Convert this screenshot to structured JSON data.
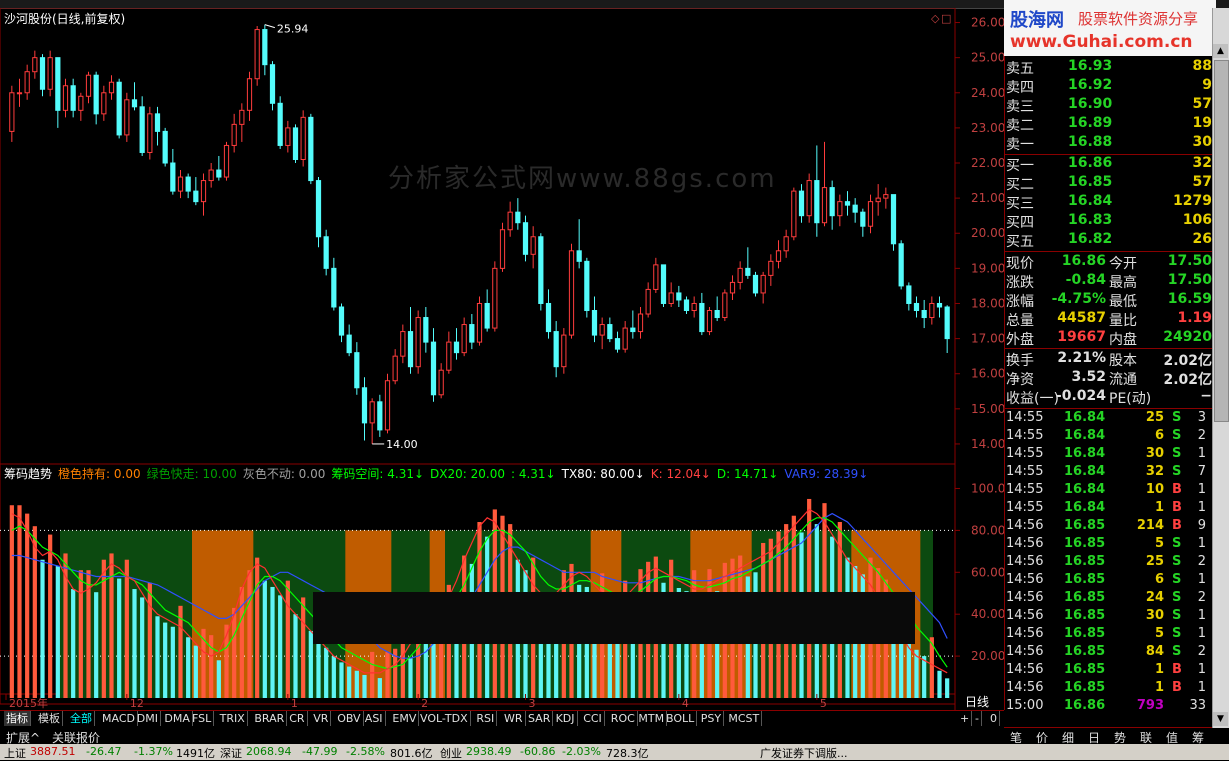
{
  "window": {
    "title": "沙河股份(日线,前复权)",
    "watermark": "分析家公式网www.88gs.com",
    "high_marker": "25.94",
    "low_marker": "14.00"
  },
  "price_axis": [
    "26.00",
    "25.00",
    "24.00",
    "23.00",
    "22.00",
    "21.00",
    "20.00",
    "19.00",
    "18.00",
    "17.00",
    "16.00",
    "15.00",
    "14.00"
  ],
  "indicator_axis": [
    "100.0",
    "80.00",
    "60.00",
    "40.00",
    "20.00"
  ],
  "period_label": "日线",
  "x_labels": [
    "2015年",
    "12",
    "1",
    "2",
    "3",
    "4",
    "5"
  ],
  "indicator_header": [
    {
      "text": "筹码趋势",
      "color": "#ffffff"
    },
    {
      "text": "橙色持有: 0.00",
      "color": "#ff8000"
    },
    {
      "text": "绿色快走: 10.00",
      "color": "#00a000"
    },
    {
      "text": "灰色不动: 0.00",
      "color": "#a0a0a0"
    },
    {
      "text": "筹码空间: 4.31↓",
      "color": "#00ff00"
    },
    {
      "text": "DX20: 20.00",
      "color": "#00ff00"
    },
    {
      "text": ": 4.31↓",
      "color": "#00ff00"
    },
    {
      "text": "TX80: 80.00↓",
      "color": "#ffffff"
    },
    {
      "text": "K: 12.04↓",
      "color": "#ff4040"
    },
    {
      "text": "D: 14.71↓",
      "color": "#00ff00"
    },
    {
      "text": "VAR9: 28.39↓",
      "color": "#3050ff"
    }
  ],
  "logo": {
    "name": "股海网",
    "slogan": "股票软件资源分享",
    "url": "www.Guhai.com.cn"
  },
  "order_book": {
    "sell": [
      {
        "label": "卖五",
        "price": "16.93",
        "vol": "88"
      },
      {
        "label": "卖四",
        "price": "16.92",
        "vol": "9"
      },
      {
        "label": "卖三",
        "price": "16.90",
        "vol": "57"
      },
      {
        "label": "卖二",
        "price": "16.89",
        "vol": "19"
      },
      {
        "label": "卖一",
        "price": "16.88",
        "vol": "30"
      }
    ],
    "buy": [
      {
        "label": "买一",
        "price": "16.86",
        "vol": "32"
      },
      {
        "label": "买二",
        "price": "16.85",
        "vol": "57"
      },
      {
        "label": "买三",
        "price": "16.84",
        "vol": "1279"
      },
      {
        "label": "买四",
        "price": "16.83",
        "vol": "106"
      },
      {
        "label": "买五",
        "price": "16.82",
        "vol": "26"
      }
    ]
  },
  "stats": [
    {
      "l1": "现价",
      "v1": "16.86",
      "c1": "#25d425",
      "l2": "今开",
      "v2": "17.50",
      "c2": "#25d425"
    },
    {
      "l1": "涨跌",
      "v1": "-0.84",
      "c1": "#25d425",
      "l2": "最高",
      "v2": "17.50",
      "c2": "#25d425"
    },
    {
      "l1": "涨幅",
      "v1": "-4.75%",
      "c1": "#25d425",
      "l2": "最低",
      "v2": "16.59",
      "c2": "#25d425"
    },
    {
      "l1": "总量",
      "v1": "44587",
      "c1": "#e7d000",
      "l2": "量比",
      "v2": "1.19",
      "c2": "#ff4040"
    },
    {
      "l1": "外盘",
      "v1": "19667",
      "c1": "#ff4040",
      "l2": "内盘",
      "v2": "24920",
      "c2": "#25d425"
    }
  ],
  "stats2": [
    {
      "l1": "换手",
      "v1": "2.21%",
      "c1": "#e0e0e0",
      "l2": "股本",
      "v2": "2.02亿",
      "c2": "#e0e0e0"
    },
    {
      "l1": "净资",
      "v1": "3.52",
      "c1": "#e0e0e0",
      "l2": "流通",
      "v2": "2.02亿",
      "c2": "#e0e0e0"
    },
    {
      "l1": "收益(一)",
      "v1": "-0.024",
      "c1": "#e0e0e0",
      "l2": "PE(动)",
      "v2": "−",
      "c2": "#e0e0e0"
    }
  ],
  "ticks": [
    {
      "t": "14:55",
      "p": "16.84",
      "v": "25",
      "d": "S",
      "n": "3"
    },
    {
      "t": "14:55",
      "p": "16.84",
      "v": "6",
      "d": "S",
      "n": "2"
    },
    {
      "t": "14:55",
      "p": "16.84",
      "v": "30",
      "d": "S",
      "n": "1"
    },
    {
      "t": "14:55",
      "p": "16.84",
      "v": "32",
      "d": "S",
      "n": "7"
    },
    {
      "t": "14:55",
      "p": "16.84",
      "v": "10",
      "d": "B",
      "n": "1"
    },
    {
      "t": "14:55",
      "p": "16.84",
      "v": "1",
      "d": "B",
      "n": "1"
    },
    {
      "t": "14:56",
      "p": "16.85",
      "v": "214",
      "d": "B",
      "n": "9"
    },
    {
      "t": "14:56",
      "p": "16.85",
      "v": "5",
      "d": "S",
      "n": "1"
    },
    {
      "t": "14:56",
      "p": "16.85",
      "v": "25",
      "d": "S",
      "n": "2"
    },
    {
      "t": "14:56",
      "p": "16.85",
      "v": "6",
      "d": "S",
      "n": "1"
    },
    {
      "t": "14:56",
      "p": "16.85",
      "v": "24",
      "d": "S",
      "n": "2"
    },
    {
      "t": "14:56",
      "p": "16.85",
      "v": "30",
      "d": "S",
      "n": "1"
    },
    {
      "t": "14:56",
      "p": "16.85",
      "v": "5",
      "d": "S",
      "n": "1"
    },
    {
      "t": "14:56",
      "p": "16.85",
      "v": "84",
      "d": "S",
      "n": "2"
    },
    {
      "t": "14:56",
      "p": "16.85",
      "v": "1",
      "d": "B",
      "n": "1"
    },
    {
      "t": "14:56",
      "p": "16.85",
      "v": "1",
      "d": "B",
      "n": "1"
    },
    {
      "t": "15:00",
      "p": "16.86",
      "v": "793",
      "d": "",
      "n": "33"
    }
  ],
  "tabs": [
    "指标",
    "模板",
    "全部",
    "MACD",
    "DMI",
    "DMA",
    "FSL",
    "TRIX",
    "BRAR",
    "CR",
    "VR",
    "OBV",
    "ASI",
    "EMV",
    "VOL-TDX",
    "RSI",
    "WR",
    "SAR",
    "KDJ",
    "CCI",
    "ROC",
    "MTM",
    "BOLL",
    "PSY",
    "MCST"
  ],
  "bottom_tabs": [
    "扩展^",
    "关联报价"
  ],
  "right_tabs": [
    "笔",
    "价",
    "细",
    "日",
    "势",
    "联",
    "值",
    "筹"
  ],
  "zoom_controls": [
    "+",
    "-",
    "0"
  ],
  "status": {
    "sh": "上证",
    "sh_val": "3887.51",
    "sh_chg": "-26.47",
    "sh_pct": "-1.37%",
    "sh_amt": "1491亿",
    "sz": "深证",
    "sz_val": "2068.94",
    "sz_chg": "-47.99",
    "sz_pct": "-2.58%",
    "sz_amt": "801.6亿",
    "cy": "创业",
    "cy_val": "2938.49",
    "cy_chg": "-60.86",
    "cy_pct": "-2.03%",
    "cy_amt": "728.3亿",
    "news": "广发证券下调版..."
  },
  "chart_data": {
    "type": "candlestick",
    "title": "沙河股份(日线,前复权)",
    "ylim": [
      13.6,
      26.3
    ],
    "candles": [
      [
        22.9,
        24.2,
        22.6,
        24.0
      ],
      [
        24.0,
        24.4,
        23.6,
        24.0
      ],
      [
        24.0,
        24.8,
        23.8,
        24.6
      ],
      [
        24.6,
        25.2,
        24.4,
        25.0
      ],
      [
        25.0,
        25.1,
        23.9,
        24.1
      ],
      [
        24.1,
        25.2,
        23.9,
        25.0
      ],
      [
        25.0,
        25.0,
        23.0,
        23.5
      ],
      [
        23.5,
        24.4,
        23.3,
        24.2
      ],
      [
        24.2,
        24.4,
        23.3,
        23.5
      ],
      [
        23.5,
        24.0,
        23.2,
        23.9
      ],
      [
        23.9,
        24.6,
        23.7,
        24.5
      ],
      [
        24.5,
        24.6,
        23.1,
        23.4
      ],
      [
        23.4,
        24.2,
        23.2,
        24.0
      ],
      [
        24.0,
        24.5,
        23.8,
        24.3
      ],
      [
        24.3,
        24.4,
        22.7,
        22.8
      ],
      [
        22.8,
        24.0,
        22.6,
        23.8
      ],
      [
        23.8,
        24.3,
        23.5,
        23.6
      ],
      [
        23.6,
        23.9,
        22.2,
        22.3
      ],
      [
        22.3,
        23.6,
        22.1,
        23.4
      ],
      [
        23.4,
        23.6,
        22.5,
        22.9
      ],
      [
        22.9,
        23.0,
        21.9,
        22.0
      ],
      [
        22.0,
        22.4,
        21.1,
        21.2
      ],
      [
        21.2,
        21.8,
        21.0,
        21.6
      ],
      [
        21.6,
        21.7,
        21.0,
        21.2
      ],
      [
        21.2,
        21.6,
        20.8,
        20.9
      ],
      [
        20.9,
        21.7,
        20.5,
        21.5
      ],
      [
        21.5,
        22.0,
        21.3,
        21.8
      ],
      [
        21.8,
        22.2,
        21.5,
        21.6
      ],
      [
        21.6,
        22.6,
        21.5,
        22.5
      ],
      [
        22.5,
        23.4,
        22.3,
        23.1
      ],
      [
        23.1,
        23.7,
        22.6,
        23.5
      ],
      [
        23.5,
        24.6,
        23.2,
        24.4
      ],
      [
        24.4,
        25.9,
        24.2,
        25.8
      ],
      [
        25.8,
        25.94,
        24.5,
        24.8
      ],
      [
        24.8,
        24.9,
        23.5,
        23.7
      ],
      [
        23.7,
        23.9,
        22.4,
        22.5
      ],
      [
        22.5,
        23.2,
        22.3,
        23.0
      ],
      [
        23.0,
        23.1,
        22.0,
        22.1
      ],
      [
        22.1,
        23.5,
        21.9,
        23.3
      ],
      [
        23.3,
        23.4,
        21.4,
        21.5
      ],
      [
        21.5,
        21.6,
        19.6,
        19.9
      ],
      [
        19.9,
        20.1,
        18.8,
        19.0
      ],
      [
        19.0,
        19.3,
        17.8,
        17.9
      ],
      [
        17.9,
        18.0,
        16.9,
        17.1
      ],
      [
        17.1,
        17.4,
        16.5,
        16.6
      ],
      [
        16.6,
        16.9,
        15.4,
        15.6
      ],
      [
        15.6,
        15.9,
        14.1,
        14.6
      ],
      [
        14.6,
        15.3,
        14.0,
        15.2
      ],
      [
        15.2,
        15.4,
        14.2,
        14.4
      ],
      [
        14.4,
        16.0,
        14.3,
        15.8
      ],
      [
        15.8,
        16.7,
        15.7,
        16.5
      ],
      [
        16.5,
        17.4,
        16.3,
        17.2
      ],
      [
        17.2,
        17.9,
        16.0,
        16.2
      ],
      [
        16.2,
        17.8,
        16.0,
        17.6
      ],
      [
        17.6,
        17.9,
        16.6,
        16.9
      ],
      [
        16.9,
        17.3,
        15.2,
        15.4
      ],
      [
        15.4,
        16.3,
        15.3,
        16.1
      ],
      [
        16.1,
        17.2,
        16.0,
        16.9
      ],
      [
        16.9,
        17.3,
        16.4,
        16.6
      ],
      [
        16.6,
        17.6,
        16.5,
        17.4
      ],
      [
        17.4,
        17.7,
        16.7,
        16.9
      ],
      [
        16.9,
        18.2,
        16.8,
        18.0
      ],
      [
        18.0,
        18.4,
        17.2,
        17.3
      ],
      [
        17.3,
        19.2,
        17.2,
        19.0
      ],
      [
        19.0,
        20.3,
        18.9,
        20.1
      ],
      [
        20.1,
        20.9,
        19.9,
        20.6
      ],
      [
        20.6,
        21.0,
        20.1,
        20.3
      ],
      [
        20.3,
        20.5,
        19.2,
        19.4
      ],
      [
        19.4,
        20.2,
        19.0,
        19.9
      ],
      [
        19.9,
        20.0,
        17.8,
        18.0
      ],
      [
        18.0,
        18.4,
        17.0,
        17.2
      ],
      [
        17.2,
        17.5,
        15.9,
        16.2
      ],
      [
        16.2,
        17.3,
        16.0,
        17.1
      ],
      [
        17.1,
        19.7,
        17.0,
        19.5
      ],
      [
        19.5,
        20.4,
        19.0,
        19.2
      ],
      [
        19.2,
        19.3,
        17.6,
        17.8
      ],
      [
        17.8,
        18.2,
        16.9,
        17.1
      ],
      [
        17.1,
        17.6,
        16.7,
        17.4
      ],
      [
        17.4,
        17.6,
        16.9,
        17.0
      ],
      [
        17.0,
        17.2,
        16.6,
        16.7
      ],
      [
        16.7,
        17.5,
        16.6,
        17.3
      ],
      [
        17.3,
        17.8,
        17.0,
        17.2
      ],
      [
        17.2,
        17.9,
        17.0,
        17.7
      ],
      [
        17.7,
        18.6,
        17.6,
        18.4
      ],
      [
        18.4,
        19.3,
        18.3,
        19.1
      ],
      [
        19.1,
        19.1,
        17.9,
        18.0
      ],
      [
        18.0,
        18.6,
        17.9,
        18.3
      ],
      [
        18.3,
        18.5,
        17.9,
        18.1
      ],
      [
        18.1,
        18.2,
        17.7,
        17.8
      ],
      [
        17.8,
        18.2,
        17.6,
        18.0
      ],
      [
        18.0,
        18.3,
        17.1,
        17.2
      ],
      [
        17.2,
        17.9,
        17.1,
        17.8
      ],
      [
        17.8,
        18.2,
        17.5,
        17.6
      ],
      [
        17.6,
        18.4,
        17.5,
        18.3
      ],
      [
        18.3,
        18.8,
        18.1,
        18.6
      ],
      [
        18.6,
        19.2,
        18.4,
        19.0
      ],
      [
        19.0,
        19.6,
        18.7,
        18.8
      ],
      [
        18.8,
        18.9,
        18.2,
        18.3
      ],
      [
        18.3,
        18.9,
        18.0,
        18.8
      ],
      [
        18.8,
        19.4,
        18.5,
        19.2
      ],
      [
        19.2,
        19.8,
        19.0,
        19.5
      ],
      [
        19.5,
        20.1,
        19.3,
        19.9
      ],
      [
        19.9,
        21.3,
        19.8,
        21.2
      ],
      [
        21.2,
        21.4,
        20.3,
        20.5
      ],
      [
        20.5,
        21.7,
        20.3,
        21.5
      ],
      [
        21.5,
        22.5,
        19.9,
        20.3
      ],
      [
        20.3,
        22.6,
        20.2,
        21.3
      ],
      [
        21.3,
        21.5,
        20.1,
        20.5
      ],
      [
        20.5,
        21.1,
        20.2,
        20.9
      ],
      [
        20.9,
        21.2,
        20.5,
        20.8
      ],
      [
        20.8,
        21.0,
        20.3,
        20.6
      ],
      [
        20.6,
        20.7,
        19.9,
        20.2
      ],
      [
        20.2,
        21.1,
        20.0,
        20.9
      ],
      [
        20.9,
        21.4,
        20.5,
        21.0
      ],
      [
        21.0,
        21.3,
        20.7,
        21.1
      ],
      [
        21.1,
        21.1,
        19.5,
        19.7
      ],
      [
        19.7,
        19.8,
        18.4,
        18.5
      ],
      [
        18.5,
        18.6,
        17.8,
        18.0
      ],
      [
        18.0,
        18.2,
        17.6,
        17.8
      ],
      [
        17.8,
        18.1,
        17.3,
        17.6
      ],
      [
        17.6,
        18.2,
        17.4,
        18.0
      ],
      [
        18.0,
        18.2,
        17.6,
        17.9
      ],
      [
        17.9,
        17.95,
        16.59,
        17.0
      ]
    ],
    "indicator_ylim": [
      0,
      105
    ],
    "K": [
      88,
      86,
      80,
      72,
      68,
      70,
      66,
      58,
      52,
      50,
      52,
      55,
      60,
      64,
      62,
      58,
      56,
      50,
      44,
      40,
      38,
      36,
      34,
      30,
      26,
      22,
      20,
      22,
      30,
      40,
      52,
      60,
      64,
      62,
      56,
      50,
      44,
      40,
      36,
      32,
      28,
      24,
      20,
      18,
      16,
      14,
      12,
      12,
      12,
      14,
      16,
      20,
      26,
      32,
      38,
      42,
      44,
      48,
      56,
      66,
      74,
      82,
      86,
      84,
      78,
      72,
      66,
      60,
      54,
      50,
      48,
      50,
      54,
      58,
      60,
      58,
      54,
      50,
      48,
      46,
      48,
      52,
      56,
      60,
      62,
      60,
      58,
      56,
      54,
      52,
      52,
      54,
      56,
      58,
      60,
      62,
      64,
      66,
      68,
      70,
      74,
      78,
      82,
      86,
      90,
      88,
      84,
      78,
      72,
      66,
      62,
      58,
      54,
      48,
      42,
      36,
      30,
      24,
      20,
      18,
      16,
      14,
      12.04
    ],
    "D": [
      80,
      82,
      80,
      76,
      72,
      70,
      68,
      64,
      60,
      56,
      54,
      54,
      56,
      58,
      60,
      58,
      56,
      54,
      50,
      46,
      42,
      40,
      38,
      36,
      32,
      28,
      24,
      22,
      24,
      30,
      38,
      46,
      54,
      58,
      58,
      56,
      52,
      48,
      44,
      40,
      36,
      32,
      28,
      24,
      22,
      20,
      18,
      16,
      15,
      14,
      15,
      16,
      20,
      24,
      30,
      36,
      40,
      44,
      48,
      54,
      62,
      70,
      76,
      80,
      80,
      78,
      74,
      70,
      64,
      58,
      54,
      52,
      52,
      54,
      56,
      56,
      55,
      53,
      51,
      49,
      48,
      49,
      51,
      54,
      57,
      58,
      58,
      57,
      56,
      54,
      53,
      53,
      54,
      55,
      57,
      58,
      60,
      62,
      64,
      66,
      69,
      72,
      76,
      80,
      84,
      86,
      86,
      84,
      80,
      76,
      72,
      68,
      64,
      60,
      55,
      50,
      45,
      40,
      34,
      30,
      26,
      20,
      14.71
    ],
    "VAR9": [
      68,
      68,
      67,
      66,
      65,
      64,
      63,
      62,
      61,
      60,
      59,
      58,
      58,
      58,
      58,
      58,
      57,
      56,
      55,
      54,
      52,
      50,
      48,
      46,
      44,
      42,
      40,
      38,
      38,
      40,
      44,
      48,
      52,
      56,
      58,
      60,
      60,
      58,
      56,
      54,
      52,
      50,
      48,
      44,
      40,
      36,
      32,
      28,
      24,
      22,
      20,
      19,
      19,
      20,
      22,
      26,
      30,
      34,
      38,
      42,
      48,
      54,
      60,
      66,
      70,
      72,
      72,
      70,
      68,
      66,
      64,
      62,
      60,
      60,
      60,
      60,
      60,
      58,
      57,
      56,
      55,
      55,
      55,
      56,
      57,
      58,
      58,
      58,
      57,
      56,
      56,
      56,
      57,
      58,
      59,
      60,
      61,
      62,
      64,
      66,
      68,
      70,
      72,
      74,
      78,
      82,
      86,
      88,
      86,
      84,
      80,
      76,
      72,
      68,
      64,
      60,
      56,
      52,
      48,
      44,
      40,
      36,
      28.39
    ]
  }
}
